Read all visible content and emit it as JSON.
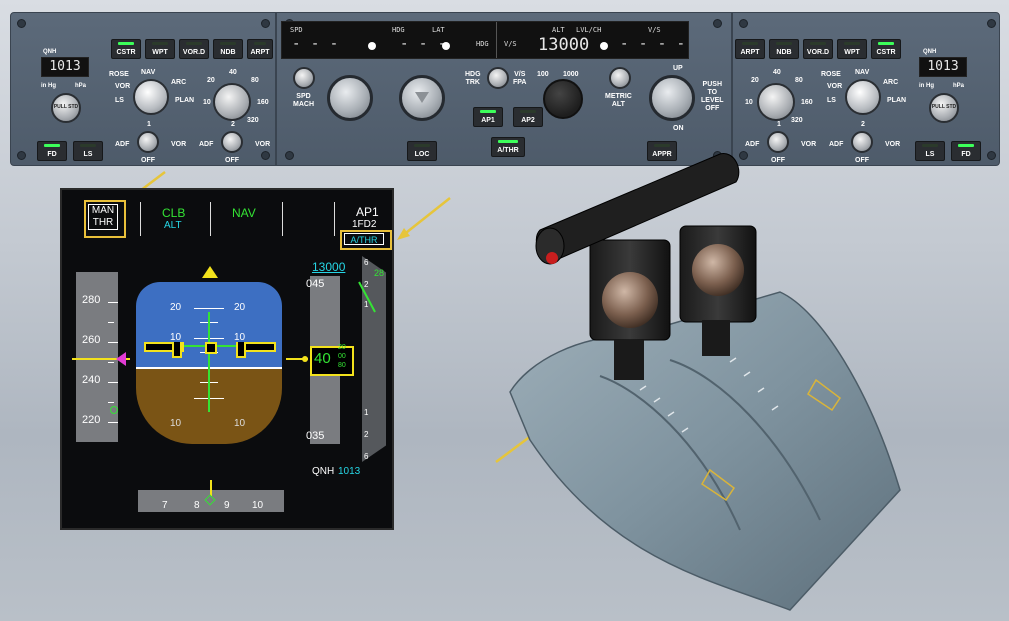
{
  "fcu": {
    "left_efis": {
      "qnh_label": "QNH",
      "qnh_value": "1013",
      "inhg_label": "in Hg",
      "hpa_label": "hPa",
      "baro_knob_text": "PULL STD",
      "buttons": [
        "CSTR",
        "WPT",
        "VOR.D",
        "NDB",
        "ARPT"
      ],
      "mode_labels": {
        "rose": "ROSE",
        "nav": "NAV",
        "arc": "ARC",
        "vor": "VOR",
        "ls": "LS",
        "plan": "PLAN"
      },
      "range_labels": [
        "20",
        "40",
        "80",
        "160",
        "320",
        "10"
      ],
      "selector1": {
        "adf": "ADF",
        "num": "1",
        "off": "OFF",
        "vor": "VOR"
      },
      "selector2": {
        "adf": "ADF",
        "num": "2",
        "off": "OFF",
        "vor": "VOR"
      },
      "fd_label": "FD",
      "ls_label": "LS"
    },
    "afs": {
      "spd_label": "SPD",
      "spd_value": "- - -",
      "hdg_label": "HDG",
      "hdg_value": "- - -",
      "lat_label": "LAT",
      "hdg_right": "HDG",
      "vs_left": "V/S",
      "alt_label": "ALT",
      "lvlch_label": "LVL/CH",
      "vs_label": "V/S",
      "alt_value": "13000",
      "vs_value": "- - - -",
      "spd_mach": "SPD\nMACH",
      "hdg_trk": "HDG\nTRK",
      "vs_fpa": "V/S\nFPA",
      "ap1": "AP1",
      "ap2": "AP2",
      "athr": "A/THR",
      "loc": "LOC",
      "appr": "APPR",
      "alt_scale_100": "100",
      "alt_scale_1000": "1000",
      "metric_alt": "METRIC\nALT",
      "up": "UP",
      "on": "ON",
      "push_level_off": "PUSH\nTO\nLEVEL\nOFF"
    },
    "right_efis": {
      "qnh_label": "QNH",
      "qnh_value": "1013",
      "inhg_label": "in Hg",
      "hpa_label": "hPa",
      "baro_knob_text": "PULL STD",
      "buttons": [
        "ARPT",
        "NDB",
        "VOR.D",
        "WPT",
        "CSTR"
      ],
      "mode_labels": {
        "rose": "ROSE",
        "nav": "NAV",
        "arc": "ARC",
        "vor": "VOR",
        "ls": "LS",
        "plan": "PLAN"
      },
      "range_labels": [
        "20",
        "40",
        "80",
        "160",
        "320",
        "10"
      ],
      "selector1": {
        "adf": "ADF",
        "num": "1",
        "off": "OFF",
        "vor": "VOR"
      },
      "selector2": {
        "adf": "ADF",
        "num": "2",
        "off": "OFF",
        "vor": "VOR"
      },
      "fd_label": "FD",
      "ls_label": "LS"
    }
  },
  "pfd": {
    "fma": {
      "col1_line1": "MAN",
      "col1_line2": "THR",
      "col2_line1": "CLB",
      "col2_line2": "ALT",
      "col3_line1": "NAV",
      "col5_line1": "AP1",
      "col5_line2": "1FD2",
      "col5_line3": "A/THR"
    },
    "speed_ticks": [
      "280",
      "260",
      "240",
      "220"
    ],
    "pitch_labels": [
      "20",
      "20",
      "10",
      "10",
      "10",
      "10"
    ],
    "alt_target": "13000",
    "alt_top": "045",
    "alt_bottom": "035",
    "alt_current": "40",
    "alt_drum": [
      "20",
      "00",
      "80"
    ],
    "vs_scale": [
      "6",
      "2",
      "1",
      "1",
      "2",
      "6"
    ],
    "vs_value": "28",
    "qnh_label": "QNH",
    "qnh_value": "1013",
    "heading_ticks": [
      "7",
      "8",
      "9",
      "10"
    ]
  }
}
